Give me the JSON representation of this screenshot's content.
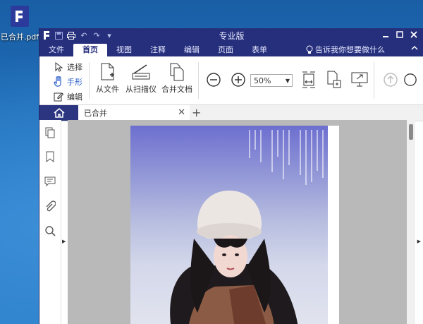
{
  "desktop": {
    "file_icon_label": "已合并.pdf"
  },
  "window": {
    "title": "专业版",
    "menu_tabs": [
      "文件",
      "首页",
      "视图",
      "注释",
      "编辑",
      "页面",
      "表单"
    ],
    "active_tab": "首页",
    "tell_me": "告诉我你想要做什么"
  },
  "ribbon": {
    "select_label": "选择",
    "hand_label": "手形",
    "edit_label": "编辑",
    "from_file_label": "从文件",
    "from_scanner_label": "从扫描仪",
    "merge_label": "合并文档",
    "zoom_value": "50%"
  },
  "doc_tabs": {
    "active_doc": "已合并"
  },
  "colors": {
    "titlebar": "#262f7c",
    "hand_tool": "#2b5fc9",
    "canvas": "#b9b9b9"
  }
}
